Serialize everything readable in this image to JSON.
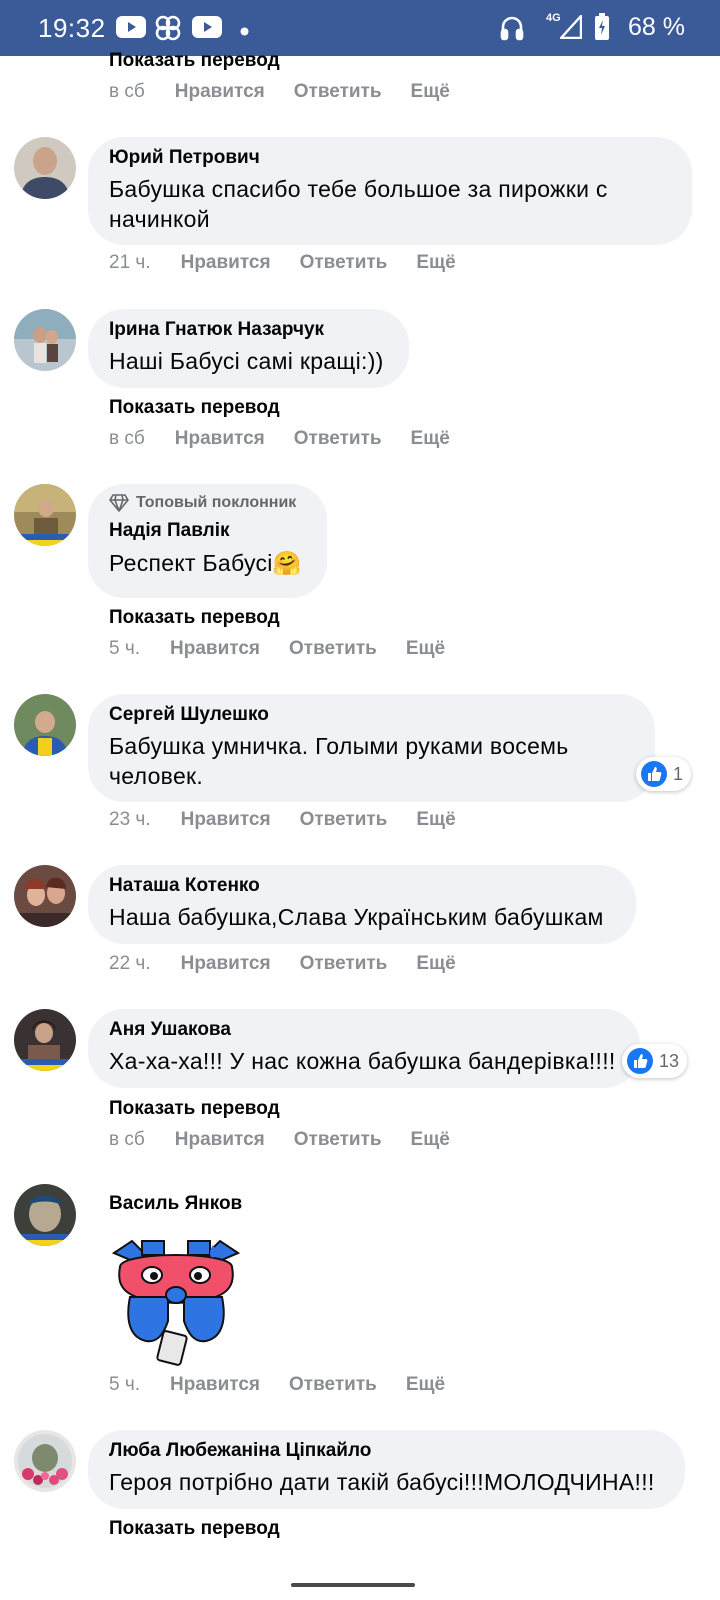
{
  "status_bar": {
    "time": "19:32",
    "battery": "68 %",
    "network": "4G",
    "icons": [
      "youtube-icon",
      "pinwheel-icon",
      "youtube-icon",
      "dot-icon",
      "headphones-icon",
      "signal-icon",
      "battery-icon"
    ]
  },
  "labels": {
    "like": "Нравится",
    "reply": "Ответить",
    "more": "Ещё",
    "show_translation": "Показать перевод",
    "top_fan": "Топовый поклонник"
  },
  "top": {
    "time": "в сб"
  },
  "comments": [
    {
      "author": "Юрий Петрович",
      "text": "Бабушка спасибо тебе большое за пирожки с начинкой",
      "time": "21 ч."
    },
    {
      "author": "Ірина Гнатюк Назарчук",
      "text": "Наші Бабусі самі кращі:))",
      "time": "в сб"
    },
    {
      "author": "Надія Павлік",
      "text": "Респект Бабусі🤗",
      "time": "5 ч."
    },
    {
      "author": "Сергей Шулешко",
      "text": "Бабушка умничка. Голыми руками восемь человек.",
      "time": "23 ч.",
      "reactions": "1"
    },
    {
      "author": "Наташа Котенко",
      "text": "Наша бабушка,Слава Українським бабушкам",
      "time": "22 ч."
    },
    {
      "author": "Аня Ушакова",
      "text": "Ха-ха-ха!!! У нас кожна бабушка бандерівка!!!!",
      "time": "в сб",
      "reactions": "13"
    },
    {
      "author": "Василь Янков",
      "time": "5 ч.",
      "sticker": "crying-red-bear-sticker"
    },
    {
      "author": "Люба Любежаніна Ціпкайло",
      "text": "Героя потрібно дати такій бабусі!!!МОЛОДЧИНА!!!"
    }
  ],
  "colors": {
    "status_bar": "#3b5a98",
    "bubble": "#f0f2f5",
    "meta": "#8a8d91",
    "like_blue": "#1877f2"
  }
}
